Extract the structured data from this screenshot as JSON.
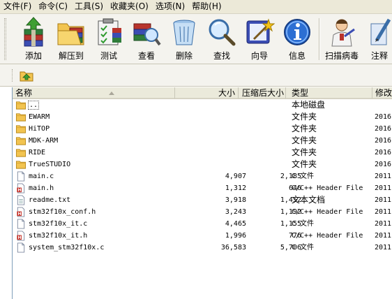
{
  "menu": [
    {
      "label": "文件(F)"
    },
    {
      "label": "命令(C)"
    },
    {
      "label": "工具(S)"
    },
    {
      "label": "收藏夹(O)"
    },
    {
      "label": "选项(N)"
    },
    {
      "label": "帮助(H)"
    }
  ],
  "toolbar": [
    {
      "label": "添加",
      "icon": "add-archive-icon"
    },
    {
      "label": "解压到",
      "icon": "extract-folder-icon"
    },
    {
      "label": "测试",
      "icon": "test-clipboard-icon"
    },
    {
      "label": "查看",
      "icon": "view-book-icon"
    },
    {
      "label": "删除",
      "icon": "recycle-bin-icon"
    },
    {
      "label": "查找",
      "icon": "magnifier-icon"
    },
    {
      "label": "向导",
      "icon": "wizard-icon"
    },
    {
      "label": "信息",
      "icon": "info-icon"
    },
    {
      "label": "扫描病毒",
      "icon": "doctor-icon"
    },
    {
      "label": "注释",
      "icon": "comment-pen-icon"
    }
  ],
  "columns": {
    "name": "名称",
    "size": "大小",
    "compressed": "压缩后大小",
    "type": "类型",
    "modified": "修改时"
  },
  "files": [
    {
      "name": "..",
      "size": "",
      "compressed": "",
      "type": "本地磁盘",
      "modified": "",
      "icon": "folder-icon"
    },
    {
      "name": "EWARM",
      "size": "",
      "compressed": "",
      "type": "文件夹",
      "modified": "2016,",
      "icon": "folder-icon"
    },
    {
      "name": "HiTOP",
      "size": "",
      "compressed": "",
      "type": "文件夹",
      "modified": "2016,",
      "icon": "folder-icon"
    },
    {
      "name": "MDK-ARM",
      "size": "",
      "compressed": "",
      "type": "文件夹",
      "modified": "2016,",
      "icon": "folder-icon"
    },
    {
      "name": "RIDE",
      "size": "",
      "compressed": "",
      "type": "文件夹",
      "modified": "2016,",
      "icon": "folder-icon"
    },
    {
      "name": "TrueSTUDIO",
      "size": "",
      "compressed": "",
      "type": "文件夹",
      "modified": "2016,",
      "icon": "folder-icon"
    },
    {
      "name": "main.c",
      "size": "4,907",
      "compressed": "2,185",
      "type": "C 文件",
      "modified": "2011,",
      "icon": "c-file-icon"
    },
    {
      "name": "main.h",
      "size": "1,312",
      "compressed": "646",
      "type": "C/C++ Header File",
      "modified": "2011,",
      "icon": "h-file-icon"
    },
    {
      "name": "readme.txt",
      "size": "3,918",
      "compressed": "1,452",
      "type": "文本文档",
      "modified": "2011,",
      "icon": "text-file-icon"
    },
    {
      "name": "stm32f10x_conf.h",
      "size": "3,243",
      "compressed": "1,192",
      "type": "C/C++ Header File",
      "modified": "2011,",
      "icon": "h-file-icon"
    },
    {
      "name": "stm32f10x_it.c",
      "size": "4,465",
      "compressed": "1,155",
      "type": "C 文件",
      "modified": "2011,",
      "icon": "c-file-icon"
    },
    {
      "name": "stm32f10x_it.h",
      "size": "1,996",
      "compressed": "776",
      "type": "C/C++ Header File",
      "modified": "2011,",
      "icon": "h-file-icon"
    },
    {
      "name": "system_stm32f10x.c",
      "size": "36,583",
      "compressed": "5,706",
      "type": "C 文件",
      "modified": "2011,",
      "icon": "c-file-icon"
    }
  ]
}
